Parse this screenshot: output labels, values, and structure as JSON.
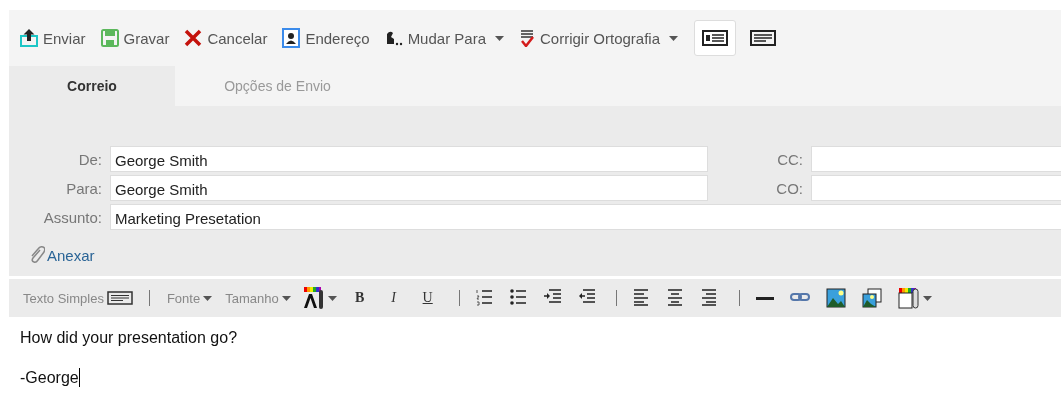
{
  "toolbar": {
    "actions": [
      {
        "kind": "button",
        "label": "Enviar"
      },
      {
        "kind": "button",
        "label": "Gravar"
      },
      {
        "kind": "button",
        "label": "Cancelar"
      },
      {
        "kind": "button",
        "label": "Endereço"
      },
      {
        "kind": "menu",
        "label": "Mudar Para"
      },
      {
        "kind": "menu",
        "label": "Corrigir Ortografia"
      }
    ],
    "view_toggles": [
      {
        "selected": true
      },
      {
        "selected": false
      }
    ]
  },
  "tabs": [
    {
      "label": "Correio",
      "selected": true
    },
    {
      "label": "Opções de Envio",
      "selected": false
    }
  ],
  "header": {
    "from": {
      "label": "De:",
      "value": "George Smith"
    },
    "to": {
      "label": "Para:",
      "value": "George Smith"
    },
    "cc": {
      "label": "CC:"
    },
    "bcc": {
      "label": "CO:"
    },
    "subject": {
      "label": "Assunto:",
      "value": "Marketing Presetation"
    }
  },
  "attach": {
    "label": "Anexar"
  },
  "format_bar": {
    "plain_text": "Texto Simples",
    "font": "Fonte",
    "size": "Tamanho",
    "styles": [
      "B",
      "I",
      "U"
    ]
  },
  "body": {
    "lines": [
      "How did your presentation go?",
      "-George"
    ]
  }
}
